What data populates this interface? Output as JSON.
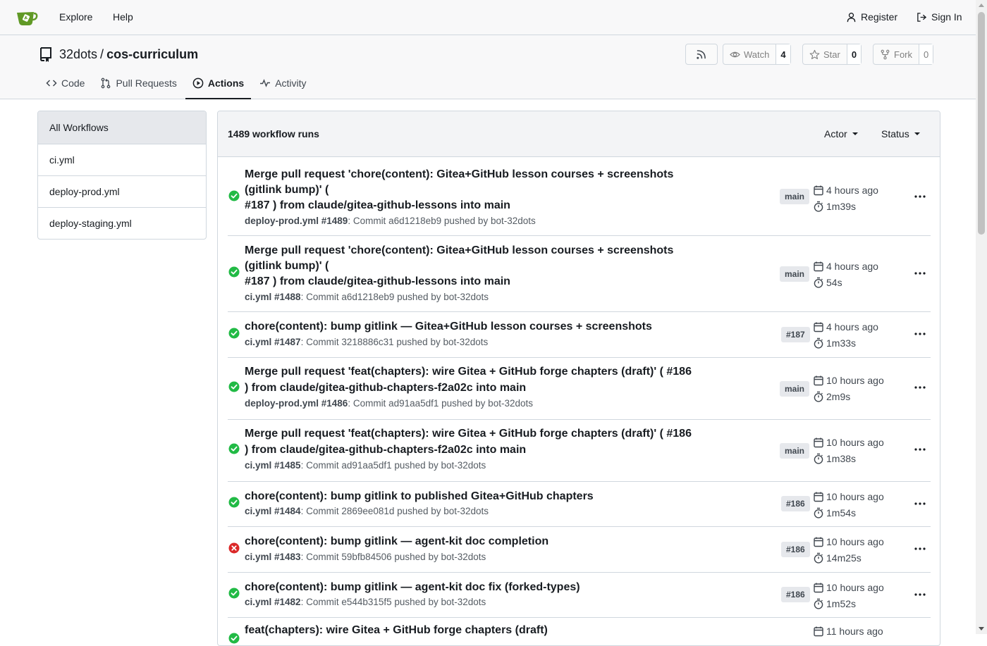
{
  "navbar": {
    "explore": "Explore",
    "help": "Help",
    "register": "Register",
    "sign_in": "Sign In"
  },
  "repo": {
    "owner": "32dots",
    "separator": "/",
    "name": "cos-curriculum",
    "watch_label": "Watch",
    "watch_count": "4",
    "star_label": "Star",
    "star_count": "0",
    "fork_label": "Fork",
    "fork_count": "0"
  },
  "tabs": [
    {
      "label": "Code",
      "icon": "code-icon"
    },
    {
      "label": "Pull Requests",
      "icon": "pull-request-icon"
    },
    {
      "label": "Actions",
      "icon": "play-circle-icon",
      "active": true
    },
    {
      "label": "Activity",
      "icon": "pulse-icon"
    }
  ],
  "sidebar": {
    "items": [
      {
        "label": "All Workflows",
        "active": true
      },
      {
        "label": "ci.yml"
      },
      {
        "label": "deploy-prod.yml"
      },
      {
        "label": "deploy-staging.yml"
      }
    ]
  },
  "runs_header": {
    "count_label": "1489 workflow runs",
    "actor_label": "Actor",
    "status_label": "Status"
  },
  "colors": {
    "success": "#21ba45",
    "failure": "#db2828",
    "border": "#d0d7de"
  },
  "runs": [
    {
      "status": "success",
      "title": "Merge pull request 'chore(content): Gitea+GitHub lesson courses + screenshots (gitlink bump)' (",
      "title2": "#187 ) from claude/gitea-github-lessons into main",
      "workflow": "deploy-prod.yml #1489",
      "detail": ": Commit a6d1218eb9 pushed by bot-32dots",
      "badge": "main",
      "time": "4 hours ago",
      "duration": "1m39s"
    },
    {
      "status": "success",
      "title": "Merge pull request 'chore(content): Gitea+GitHub lesson courses + screenshots (gitlink bump)' (",
      "title2": "#187 ) from claude/gitea-github-lessons into main",
      "workflow": "ci.yml #1488",
      "detail": ": Commit a6d1218eb9 pushed by bot-32dots",
      "badge": "main",
      "time": "4 hours ago",
      "duration": "54s"
    },
    {
      "status": "success",
      "title": "chore(content): bump gitlink — Gitea+GitHub lesson courses + screenshots",
      "title2": "",
      "workflow": "ci.yml #1487",
      "detail": ": Commit 3218886c31 pushed by bot-32dots",
      "badge": "#187",
      "time": "4 hours ago",
      "duration": "1m33s"
    },
    {
      "status": "success",
      "title": "Merge pull request 'feat(chapters): wire Gitea + GitHub forge chapters (draft)' ( #186",
      "title2": ") from claude/gitea-github-chapters-f2a02c into main",
      "workflow": "deploy-prod.yml #1486",
      "detail": ": Commit ad91aa5df1 pushed by bot-32dots",
      "badge": "main",
      "time": "10 hours ago",
      "duration": "2m9s"
    },
    {
      "status": "success",
      "title": "Merge pull request 'feat(chapters): wire Gitea + GitHub forge chapters (draft)' ( #186",
      "title2": ") from claude/gitea-github-chapters-f2a02c into main",
      "workflow": "ci.yml #1485",
      "detail": ": Commit ad91aa5df1 pushed by bot-32dots",
      "badge": "main",
      "time": "10 hours ago",
      "duration": "1m38s"
    },
    {
      "status": "success",
      "title": "chore(content): bump gitlink to published Gitea+GitHub chapters",
      "title2": "",
      "workflow": "ci.yml #1484",
      "detail": ": Commit 2869ee081d pushed by bot-32dots",
      "badge": "#186",
      "time": "10 hours ago",
      "duration": "1m54s"
    },
    {
      "status": "failure",
      "title": "chore(content): bump gitlink — agent-kit doc completion",
      "title2": "",
      "workflow": "ci.yml #1483",
      "detail": ": Commit 59bfb84506 pushed by bot-32dots",
      "badge": "#186",
      "time": "10 hours ago",
      "duration": "14m25s"
    },
    {
      "status": "success",
      "title": "chore(content): bump gitlink — agent-kit doc fix (forked-types)",
      "title2": "",
      "workflow": "ci.yml #1482",
      "detail": ": Commit e544b315f5 pushed by bot-32dots",
      "badge": "#186",
      "time": "10 hours ago",
      "duration": "1m52s"
    },
    {
      "status": "success",
      "title": "feat(chapters): wire Gitea + GitHub forge chapters (draft)",
      "title2": "",
      "workflow": "",
      "detail": "",
      "badge": "",
      "time": "11 hours ago",
      "duration": ""
    }
  ]
}
